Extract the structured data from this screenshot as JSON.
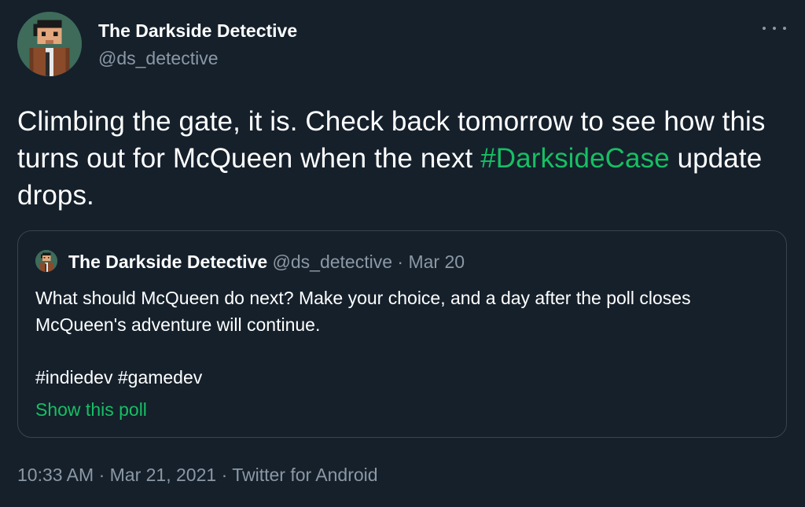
{
  "author": {
    "display_name": "The Darkside Detective",
    "handle": "@ds_detective"
  },
  "more_icon": "more-horizontal-icon",
  "tweet": {
    "text_part1": "Climbing the gate, it is. Check back tomorrow to see how this turns out for McQueen when the next ",
    "hashtag": "#DarksideCase",
    "text_part2": " update drops."
  },
  "quoted_tweet": {
    "display_name": "The Darkside Detective",
    "handle": "@ds_detective",
    "separator": "·",
    "date": "Mar 20",
    "text": "What should McQueen do next? Make your choice, and a day after the poll closes McQueen's adventure will continue.",
    "hashtags": "#indiedev #gamedev",
    "poll_link": "Show this poll"
  },
  "footer": {
    "time": "10:33 AM",
    "date": "Mar 21, 2021",
    "source": "Twitter for Android",
    "separator": "·"
  },
  "colors": {
    "background": "#15202b",
    "accent": "#17bf63",
    "secondary_text": "#8b98a5",
    "border": "#38444d"
  }
}
